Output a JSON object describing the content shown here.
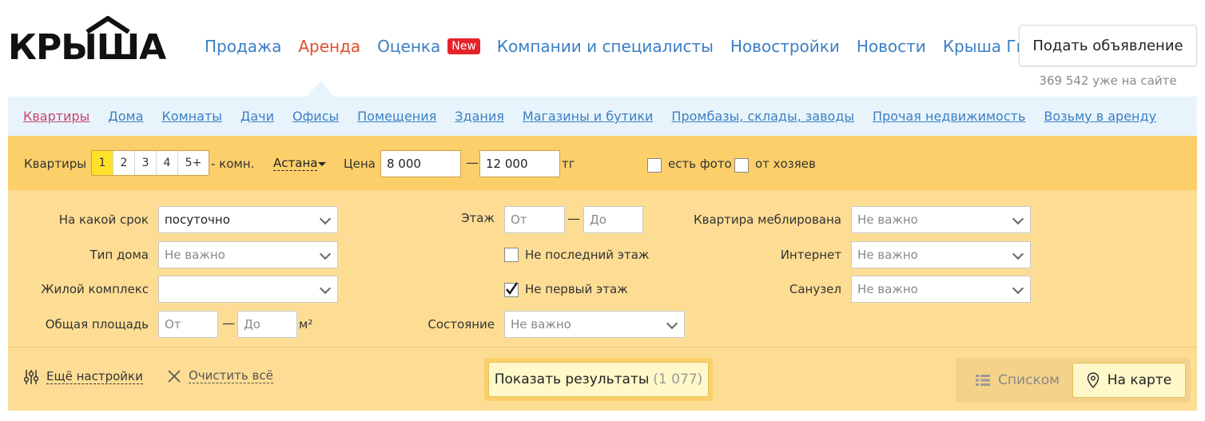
{
  "logo": {
    "text": "КРЫША"
  },
  "nav": {
    "items": [
      {
        "label": "Продажа",
        "active": false
      },
      {
        "label": "Аренда",
        "active": true
      },
      {
        "label": "Оценка",
        "badge": "New",
        "active": false
      },
      {
        "label": "Компании и специалисты",
        "active": false
      },
      {
        "label": "Новостройки",
        "active": false
      },
      {
        "label": "Новости",
        "active": false
      },
      {
        "label": "Крыша Гид",
        "active": false
      }
    ]
  },
  "header": {
    "post_button": "Подать объявление",
    "online_count": "369 542 уже на сайте"
  },
  "categories": [
    "Квартиры",
    "Дома",
    "Комнаты",
    "Дачи",
    "Офисы",
    "Помещения",
    "Здания",
    "Магазины и бутики",
    "Промбазы, склады, заводы",
    "Прочая недвижимость",
    "Возьму в аренду"
  ],
  "quick": {
    "type_label": "Квартиры",
    "rooms": [
      "1",
      "2",
      "3",
      "4",
      "5+"
    ],
    "rooms_selected": "1",
    "rooms_suffix": "- комн.",
    "city": "Астана",
    "price_label": "Цена",
    "price_from": "8 000",
    "price_to": "12 000",
    "currency": "тг",
    "dash": "—",
    "with_photo": "есть фото",
    "from_owner": "от хозяев"
  },
  "filters": {
    "term_label": "На какой срок",
    "term_value": "посуточно",
    "house_type_label": "Тип дома",
    "house_type_value": "Не важно",
    "complex_label": "Жилой комплекс",
    "complex_value": "",
    "area_label": "Общая площадь",
    "area_from_placeholder": "От",
    "area_to_placeholder": "До",
    "area_unit": "м²",
    "floor_label": "Этаж",
    "floor_from_placeholder": "От",
    "floor_to_placeholder": "До",
    "not_last_floor": "Не последний этаж",
    "not_last_floor_checked": false,
    "not_first_floor": "Не первый этаж",
    "not_first_floor_checked": true,
    "condition_label": "Состояние",
    "condition_value": "Не важно",
    "furnished_label": "Квартира меблирована",
    "furnished_value": "Не важно",
    "internet_label": "Интернет",
    "internet_value": "Не важно",
    "bathroom_label": "Санузел",
    "bathroom_value": "Не важно",
    "dash": "—"
  },
  "bottom": {
    "more_settings": "Ещё настройки",
    "clear_all": "Очистить всё",
    "show_results": "Показать результаты",
    "results_count": "(1 077)",
    "view_list": "Списком",
    "view_map": "На карте"
  },
  "colors": {
    "link": "#3b7fc4",
    "active_nav": "#e0502a",
    "badge": "#e4242a",
    "quickbar_bg": "#fccf6a",
    "filters_bg": "#fddd94",
    "catbar_bg": "#e8f4fb"
  }
}
